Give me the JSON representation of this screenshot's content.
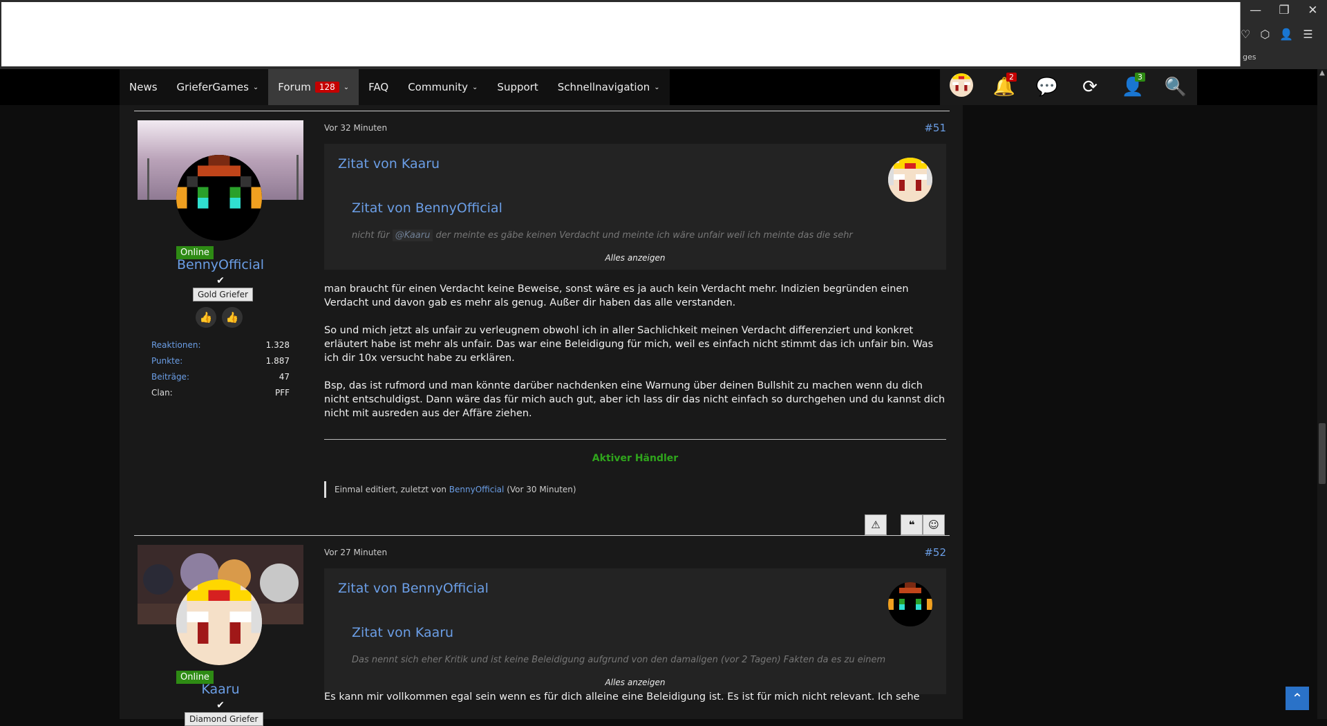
{
  "window": {
    "minimize": "—",
    "restore": "❐",
    "close": "✕",
    "toolbar_text": "ges"
  },
  "nav": {
    "items": [
      {
        "label": "News",
        "has_dropdown": false
      },
      {
        "label": "GrieferGames",
        "has_dropdown": true
      },
      {
        "label": "Forum",
        "has_dropdown": true,
        "badge": "128"
      },
      {
        "label": "FAQ",
        "has_dropdown": false
      },
      {
        "label": "Community",
        "has_dropdown": true
      },
      {
        "label": "Support",
        "has_dropdown": false
      },
      {
        "label": "Schnellnavigation",
        "has_dropdown": true
      }
    ],
    "notifications_badge": "2",
    "friends_badge": "3"
  },
  "posts": [
    {
      "user": {
        "name": "BennyOfficial",
        "status": "Online",
        "rank": "Gold Griefer",
        "stats": [
          {
            "label": "Reaktionen:",
            "value": "1.328"
          },
          {
            "label": "Punkte:",
            "value": "1.887"
          },
          {
            "label": "Beiträge:",
            "value": "47"
          },
          {
            "label": "Clan:",
            "value": "PFF"
          }
        ]
      },
      "time": "Vor 32 Minuten",
      "number": "#51",
      "quote_outer": "Zitat von Kaaru",
      "quote_inner": "Zitat von BennyOfficial",
      "quote_text_before": "nicht für",
      "quote_mention": "@Kaaru",
      "quote_text_after": "der meinte es gäbe keinen Verdacht und meinte ich wäre unfair weil ich meinte das die sehr",
      "show_all": "Alles anzeigen",
      "paragraphs": [
        "man braucht für einen Verdacht keine Beweise, sonst wäre es ja auch kein Verdacht mehr. Indizien begründen einen Verdacht und davon gab es mehr als genug. Außer dir haben das alle verstanden.",
        "So und mich jetzt als unfair zu verleugnem obwohl ich in aller Sachlichkeit meinen Verdacht differenziert und konkret erläutert habe ist mehr als unfair. Das war eine Beleidigung für mich, weil es einfach nicht stimmt das ich unfair bin. Was ich dir 10x versucht habe zu erklären.",
        "Bsp, das ist rufmord und man könnte darüber nachdenken eine Warnung über deinen Bullshit zu machen wenn du dich nicht entschuldigst. Dann wäre das für mich auch gut, aber ich lass dir das nicht einfach so durchgehen und du kannst dich nicht mit ausreden aus der Affäre ziehen."
      ],
      "signature": "Aktiver Händler",
      "edit_prefix": "Einmal editiert, zuletzt von",
      "edit_user": "BennyOfficial",
      "edit_suffix": "(Vor 30 Minuten)"
    },
    {
      "user": {
        "name": "Kaaru",
        "status": "Online",
        "rank": "Diamond Griefer"
      },
      "time": "Vor 27 Minuten",
      "number": "#52",
      "quote_outer": "Zitat von BennyOfficial",
      "quote_inner": "Zitat von Kaaru",
      "quote_text": "Das nennt sich eher Kritik und ist keine Beleidigung aufgrund von den damaligen (vor 2 Tagen) Fakten da es zu einem",
      "show_all": "Alles anzeigen",
      "paragraph": "Es kann mir vollkommen egal sein wenn es für dich alleine eine Beleidigung ist. Es ist für mich nicht relevant. Ich sehe auch nichts daran"
    }
  ],
  "colors": {
    "accent": "#6b9ee6",
    "online": "#2e8b14",
    "signature": "#2fa51c",
    "badge": "#c40000"
  }
}
